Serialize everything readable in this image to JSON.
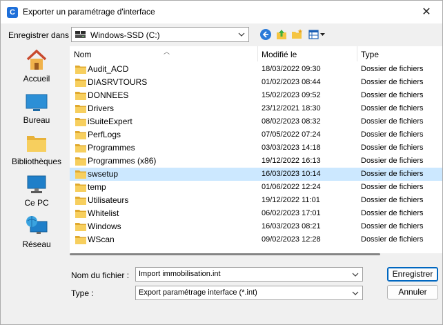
{
  "window": {
    "title": "Exporter un paramétrage d'interface",
    "close_glyph": "✕",
    "app_glyph": "C"
  },
  "toolbar": {
    "save_in_label": "Enregistrer dans :",
    "location": "Windows-SSD (C:)",
    "icons": [
      "back-icon",
      "up-folder-icon",
      "new-folder-icon",
      "view-menu-icon"
    ]
  },
  "places": [
    {
      "label": "Accueil",
      "icon": "home-icon"
    },
    {
      "label": "Bureau",
      "icon": "desktop-icon"
    },
    {
      "label": "Bibliothèques",
      "icon": "libraries-icon"
    },
    {
      "label": "Ce PC",
      "icon": "computer-icon"
    },
    {
      "label": "Réseau",
      "icon": "network-icon"
    }
  ],
  "columns": {
    "name": "Nom",
    "modified": "Modifié le",
    "type": "Type"
  },
  "files": [
    {
      "name": "Audit_ACD",
      "modified": "18/03/2022 09:30",
      "type": "Dossier de fichiers"
    },
    {
      "name": "DIASRVTOURS",
      "modified": "01/02/2023 08:44",
      "type": "Dossier de fichiers"
    },
    {
      "name": "DONNEES",
      "modified": "15/02/2023 09:52",
      "type": "Dossier de fichiers"
    },
    {
      "name": "Drivers",
      "modified": "23/12/2021 18:30",
      "type": "Dossier de fichiers"
    },
    {
      "name": "iSuiteExpert",
      "modified": "08/02/2023 08:32",
      "type": "Dossier de fichiers"
    },
    {
      "name": "PerfLogs",
      "modified": "07/05/2022 07:24",
      "type": "Dossier de fichiers"
    },
    {
      "name": "Programmes",
      "modified": "03/03/2023 14:18",
      "type": "Dossier de fichiers"
    },
    {
      "name": "Programmes (x86)",
      "modified": "19/12/2022 16:13",
      "type": "Dossier de fichiers"
    },
    {
      "name": "swsetup",
      "modified": "16/03/2023 10:14",
      "type": "Dossier de fichiers",
      "selected": true
    },
    {
      "name": "temp",
      "modified": "01/06/2022 12:24",
      "type": "Dossier de fichiers"
    },
    {
      "name": "Utilisateurs",
      "modified": "19/12/2022 11:01",
      "type": "Dossier de fichiers"
    },
    {
      "name": "Whitelist",
      "modified": "06/02/2023 17:01",
      "type": "Dossier de fichiers"
    },
    {
      "name": "Windows",
      "modified": "16/03/2023 08:21",
      "type": "Dossier de fichiers"
    },
    {
      "name": "WScan",
      "modified": "09/02/2023 12:28",
      "type": "Dossier de fichiers"
    }
  ],
  "filename": {
    "label": "Nom du fichier :",
    "value": "Import immobilisation.int"
  },
  "filetype": {
    "label": "Type :",
    "value": "Export paramétrage interface (*.int)"
  },
  "buttons": {
    "save": "Enregistrer",
    "cancel": "Annuler"
  },
  "colors": {
    "accent": "#0067c0",
    "selection": "#cce8ff",
    "folder": "#f5c542"
  }
}
